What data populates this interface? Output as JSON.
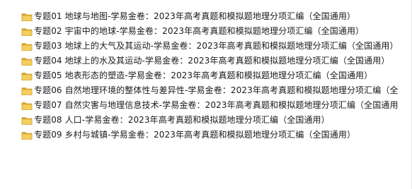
{
  "file_list": {
    "items": [
      {
        "label": "专题01 地球与地图-学易金卷：2023年高考真题和模拟题地理分项汇编（全国通用）",
        "icon": "folder-icon"
      },
      {
        "label": "专题02 宇宙中的地球-学易金卷：2023年高考真题和模拟题地理分项汇编（全国通用）",
        "icon": "folder-icon"
      },
      {
        "label": "专题03 地球上的大气及其运动-学易金卷：2023年高考真题和模拟题地理分项汇编（全国通用）",
        "icon": "folder-icon"
      },
      {
        "label": "专题04 地球上的水及其运动-学易金卷：2023年高考真题和模拟题地理分项汇编（全国通用）",
        "icon": "folder-icon"
      },
      {
        "label": "专题05 地表形态的塑造-学易金卷：2023年高考真题和模拟题地理分项汇编（全国通用）",
        "icon": "folder-icon"
      },
      {
        "label": "专题06 自然地理环境的整体性与差异性-学易金卷：2023年高考真题和模拟题地理分项汇编（全",
        "icon": "folder-icon"
      },
      {
        "label": "专题07 自然灾害与地理信息技术-学易金卷：2023年高考真题和模拟题地理分项汇编（全国通用",
        "icon": "folder-icon"
      },
      {
        "label": "专题08 人口-学易金卷：2023年高考真题和模拟题地理分项汇编（全国通用）",
        "icon": "folder-icon"
      },
      {
        "label": "专题09 乡村与城镇-学易金卷：2023年高考真题和模拟题地理分项汇编（全国通用）",
        "icon": "folder-icon"
      }
    ],
    "colors": {
      "folder_back": "#d9a831",
      "folder_front": "#f5cf5e",
      "folder_edge": "#c89321",
      "text": "#1a1a1a",
      "background": "#ffffff"
    }
  }
}
